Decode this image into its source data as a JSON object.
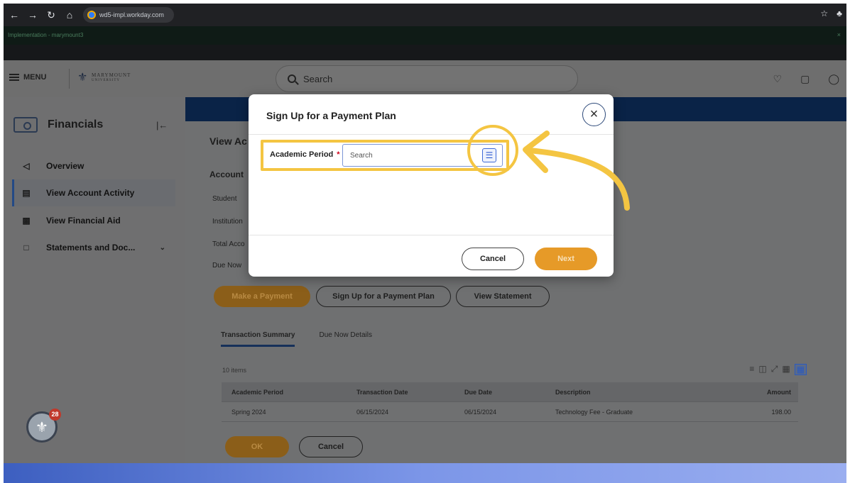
{
  "browser": {
    "url": "wd5-impl.workday.com"
  },
  "env_bar": {
    "text": "Implementation - marymount3"
  },
  "header": {
    "menu_label": "MENU",
    "logo_text": "MARYMOUNT",
    "logo_subtext": "UNIVERSITY",
    "search_placeholder": "Search"
  },
  "sidebar": {
    "title": "Financials",
    "items": [
      {
        "label": "Overview",
        "icon": "megaphone-icon"
      },
      {
        "label": "View Account Activity",
        "icon": "list-icon",
        "active": true
      },
      {
        "label": "View Financial Aid",
        "icon": "money-icon"
      },
      {
        "label": "Statements and Doc...",
        "icon": "folder-icon"
      }
    ],
    "notification_count": "28"
  },
  "main": {
    "page_title": "View Ac",
    "section_title": "Account",
    "field_labels": [
      "Student",
      "Institution",
      "Total Acco",
      "Due Now"
    ],
    "actions": {
      "make_payment": "Make a Payment",
      "payment_plan": "Sign Up for a Payment Plan",
      "view_statement": "View Statement"
    },
    "tabs": [
      "Transaction Summary",
      "Due Now Details"
    ],
    "items_count": "10 items",
    "table": {
      "columns": [
        "Academic Period",
        "Transaction Date",
        "Due Date",
        "Description",
        "Amount"
      ],
      "rows": [
        [
          "Spring 2024",
          "06/15/2024",
          "06/15/2024",
          "Technology Fee - Graduate",
          "198.00"
        ]
      ]
    },
    "footer": {
      "ok_label": "OK",
      "cancel_label": "Cancel"
    }
  },
  "modal": {
    "title": "Sign Up for a Payment Plan",
    "field_label": "Academic Period",
    "required_marker": "*",
    "input_placeholder": "Search",
    "cancel_label": "Cancel",
    "next_label": "Next"
  },
  "colors": {
    "highlight": "#f4c542",
    "accent_blue": "#0a2347",
    "next_orange": "#e69a28"
  }
}
